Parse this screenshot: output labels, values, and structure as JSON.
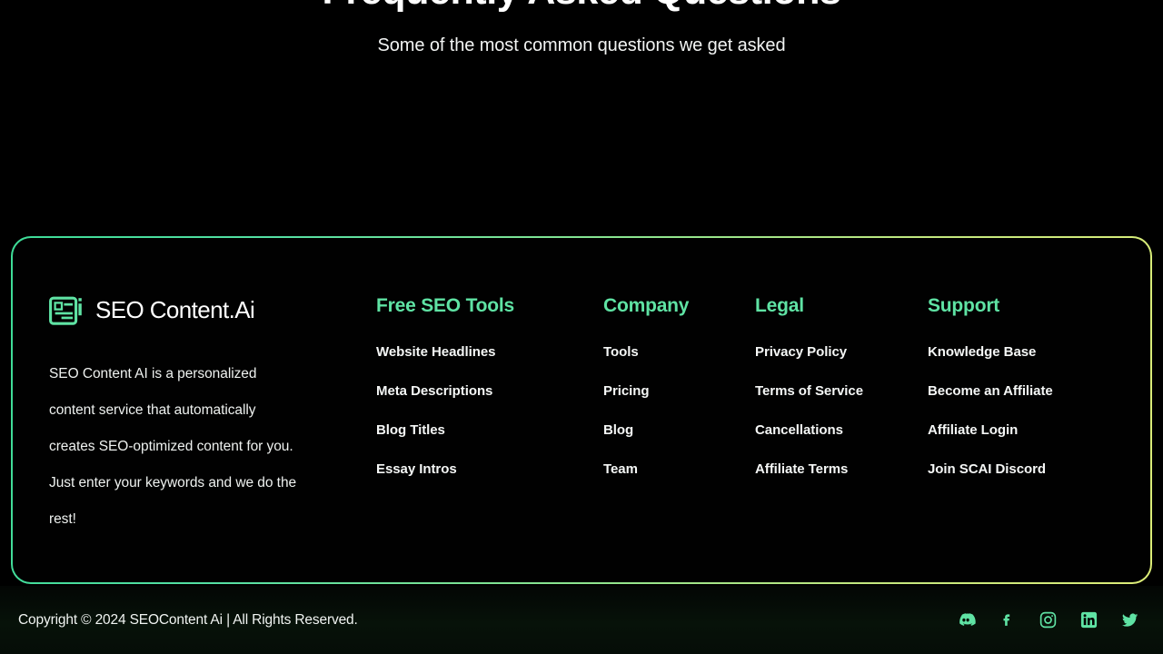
{
  "faq": {
    "title": "Frequently Asked Questions",
    "subtitle": "Some of the most common questions we get asked"
  },
  "footer": {
    "brand": {
      "logo_icon": "seo-content-ai-logo-icon",
      "name": "SEO Content.Ai",
      "description": "SEO Content AI is a personalized content service that automatically creates SEO-optimized content for you. Just enter your keywords and we do the rest!"
    },
    "columns": [
      {
        "title": "Free SEO Tools",
        "links": [
          "Website Headlines",
          "Meta Descriptions",
          "Blog Titles",
          "Essay Intros"
        ]
      },
      {
        "title": "Company",
        "links": [
          "Tools",
          "Pricing",
          "Blog",
          "Team"
        ]
      },
      {
        "title": "Legal",
        "links": [
          "Privacy Policy",
          "Terms of Service",
          "Cancellations",
          "Affiliate Terms"
        ]
      },
      {
        "title": "Support",
        "links": [
          "Knowledge Base",
          "Become an Affiliate",
          "Affiliate Login",
          "Join SCAI Discord"
        ]
      }
    ],
    "copyright": "Copyright © 2024 SEOContent Ai | All Rights Reserved.",
    "socials": [
      {
        "name": "discord-icon"
      },
      {
        "name": "facebook-icon"
      },
      {
        "name": "instagram-icon"
      },
      {
        "name": "linkedin-icon"
      },
      {
        "name": "twitter-icon"
      }
    ]
  },
  "colors": {
    "background": "#000000",
    "accent_green": "#5fe3a4",
    "border_gradient_start": "#3ddc97",
    "border_gradient_end": "#dced77",
    "text_primary": "#ffffff",
    "bottom_bar": "#071209"
  }
}
